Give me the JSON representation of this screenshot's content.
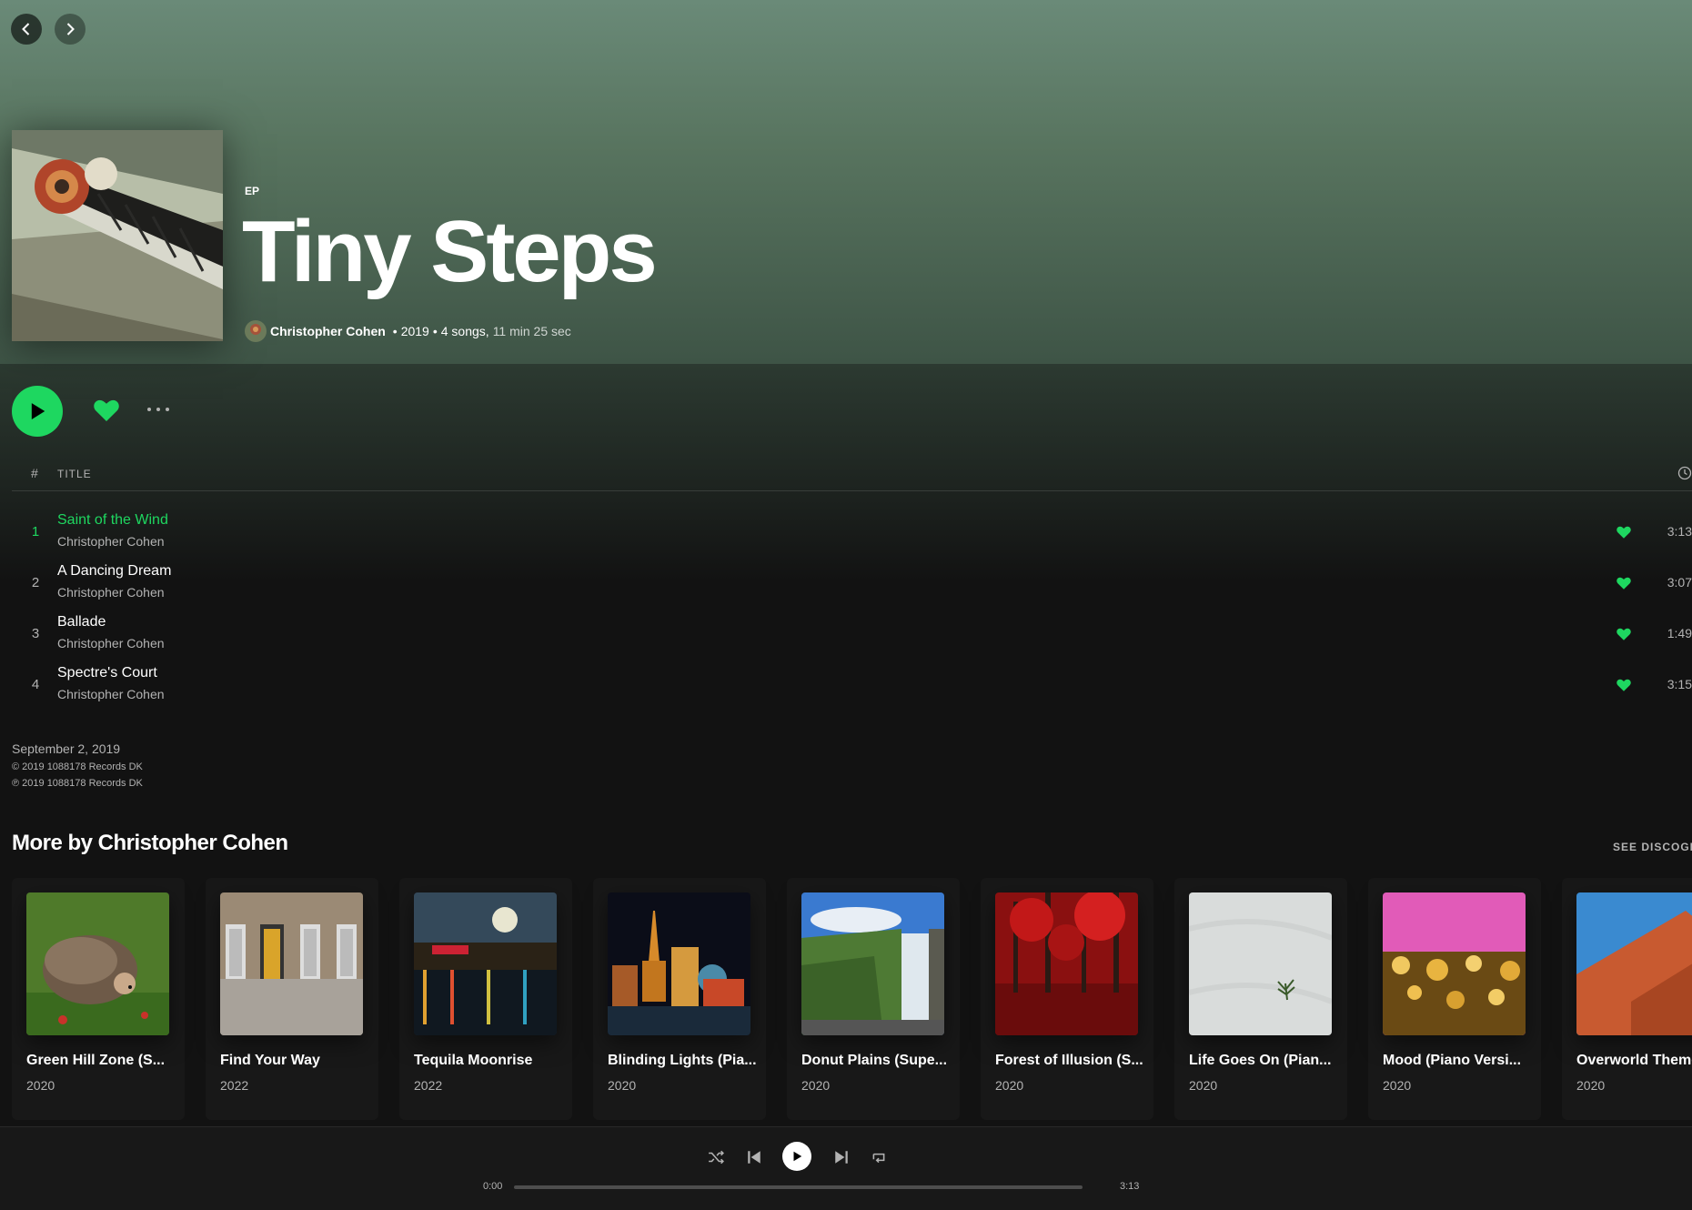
{
  "album": {
    "type": "EP",
    "title": "Tiny Steps",
    "artist": "Christopher Cohen",
    "year": "2019",
    "song_count": "4 songs,",
    "duration": "11 min 25 sec",
    "separator": "•"
  },
  "table": {
    "num_header": "#",
    "title_header": "TITLE"
  },
  "tracks": [
    {
      "num": "1",
      "name": "Saint of the Wind",
      "artist": "Christopher Cohen",
      "duration": "3:13"
    },
    {
      "num": "2",
      "name": "A Dancing Dream",
      "artist": "Christopher Cohen",
      "duration": "3:07"
    },
    {
      "num": "3",
      "name": "Ballade",
      "artist": "Christopher Cohen",
      "duration": "1:49"
    },
    {
      "num": "4",
      "name": "Spectre's Court",
      "artist": "Christopher Cohen",
      "duration": "3:15"
    }
  ],
  "release": {
    "date": "September 2, 2019",
    "copyright": "© 2019 1088178 Records DK",
    "phonogram": "℗ 2019 1088178 Records DK"
  },
  "more_by": {
    "title": "More by Christopher Cohen",
    "see_all": "SEE DISCOGRAPHY",
    "albums": [
      {
        "name": "Green Hill Zone (S...",
        "year": "2020"
      },
      {
        "name": "Find Your Way",
        "year": "2022"
      },
      {
        "name": "Tequila Moonrise",
        "year": "2022"
      },
      {
        "name": "Blinding Lights (Pia...",
        "year": "2020"
      },
      {
        "name": "Donut Plains (Supe...",
        "year": "2020"
      },
      {
        "name": "Forest of Illusion (S...",
        "year": "2020"
      },
      {
        "name": "Life Goes On (Pian...",
        "year": "2020"
      },
      {
        "name": "Mood (Piano Versi...",
        "year": "2020"
      },
      {
        "name": "Overworld Theme",
        "year": "2020"
      }
    ]
  },
  "player": {
    "current_time": "0:00",
    "total_time": "3:13",
    "progress": 0
  },
  "colors": {
    "accent": "#1ed760",
    "background": "#121212",
    "hero": "#6a8a78"
  }
}
